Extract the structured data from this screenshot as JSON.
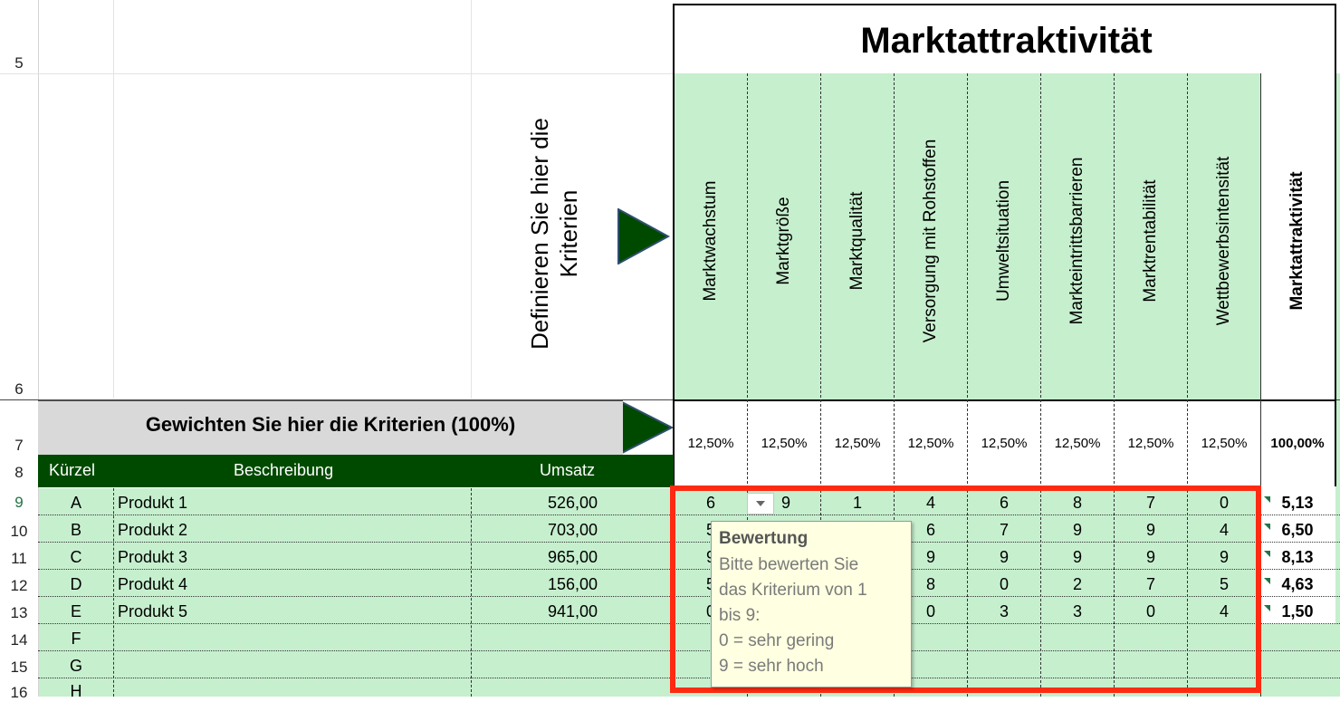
{
  "sheet": {
    "title": "Marktattraktivität",
    "define_label": "Definieren Sie hier die Kriterien",
    "weight_banner": "Gewichten Sie hier die Kriterien (100%)",
    "row_numbers": [
      "5",
      "6",
      "7",
      "8",
      "9",
      "10",
      "11",
      "12",
      "13",
      "14",
      "15",
      "16"
    ],
    "table_headers": {
      "kuerzel": "Kürzel",
      "beschreibung": "Beschreibung",
      "umsatz": "Umsatz"
    },
    "criteria": [
      {
        "name": "Marktwachstum",
        "weight": "12,50%"
      },
      {
        "name": "Marktgröße",
        "weight": "12,50%"
      },
      {
        "name": "Marktqualität",
        "weight": "12,50%"
      },
      {
        "name": "Versorgung mit Rohstoffen",
        "weight": "12,50%"
      },
      {
        "name": "Umweltsituation",
        "weight": "12,50%"
      },
      {
        "name": "Markteintrittsbarrieren",
        "weight": "12,50%"
      },
      {
        "name": "Marktrentabilität",
        "weight": "12,50%"
      },
      {
        "name": "Wettbewerbsintensität",
        "weight": "12,50%"
      }
    ],
    "total_column": {
      "name": "Marktattraktivität",
      "weight": "100,00%"
    },
    "rows": [
      {
        "code": "A",
        "desc": "Produkt 1",
        "umsatz": "526,00",
        "scores": [
          "6",
          "9",
          "1",
          "4",
          "6",
          "8",
          "7",
          "0"
        ],
        "total": "5,13"
      },
      {
        "code": "B",
        "desc": "Produkt 2",
        "umsatz": "703,00",
        "scores": [
          "5",
          "",
          "",
          "6",
          "7",
          "9",
          "9",
          "4"
        ],
        "total": "6,50"
      },
      {
        "code": "C",
        "desc": "Produkt 3",
        "umsatz": "965,00",
        "scores": [
          "9",
          "",
          "",
          "9",
          "9",
          "9",
          "9",
          "9"
        ],
        "total": "8,13"
      },
      {
        "code": "D",
        "desc": "Produkt 4",
        "umsatz": "156,00",
        "scores": [
          "5",
          "",
          "",
          "8",
          "0",
          "2",
          "7",
          "5"
        ],
        "total": "4,63"
      },
      {
        "code": "E",
        "desc": "Produkt 5",
        "umsatz": "941,00",
        "scores": [
          "0",
          "",
          "",
          "0",
          "3",
          "3",
          "0",
          "4"
        ],
        "total": "1,50"
      },
      {
        "code": "F",
        "desc": "",
        "umsatz": "",
        "scores": [
          "",
          "",
          "",
          "",
          "",
          "",
          "",
          ""
        ],
        "total": ""
      },
      {
        "code": "G",
        "desc": "",
        "umsatz": "",
        "scores": [
          "",
          "",
          "",
          "",
          "",
          "",
          "",
          ""
        ],
        "total": ""
      },
      {
        "code": "H",
        "desc": "",
        "umsatz": "",
        "scores": [
          "",
          "",
          "",
          "",
          "",
          "",
          "",
          ""
        ],
        "total": ""
      }
    ]
  },
  "tooltip": {
    "title": "Bewertung",
    "lines": [
      "Bitte bewerten Sie",
      "das Kriterium von 1",
      "bis 9:",
      "0 = sehr gering",
      "9 = sehr hoch"
    ]
  },
  "colors": {
    "light_green": "#c6efce",
    "dark_green": "#004a00",
    "highlight_red": "#ff2a12",
    "banner_gray": "#d9d9d9",
    "tooltip_bg": "#ffffe1"
  }
}
